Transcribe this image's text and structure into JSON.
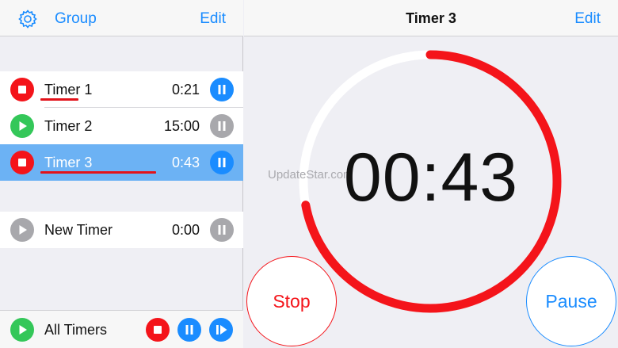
{
  "left_nav": {
    "group_label": "Group",
    "edit_label": "Edit"
  },
  "timers": [
    {
      "name": "Timer 1",
      "time": "0:21",
      "status": "running"
    },
    {
      "name": "Timer 2",
      "time": "15:00",
      "status": "idle"
    },
    {
      "name": "Timer 3",
      "time": "0:43",
      "status": "running",
      "selected": true
    }
  ],
  "new_timer": {
    "name": "New Timer",
    "time": "0:00"
  },
  "all_timers": {
    "label": "All Timers"
  },
  "detail": {
    "title": "Timer 3",
    "edit_label": "Edit",
    "remaining": "00:43",
    "progress_remaining": 0.72,
    "stop_label": "Stop",
    "pause_label": "Pause",
    "watermark": "UpdateStar.com"
  },
  "colors": {
    "accent": "#1a8cff",
    "stop": "#f4141a",
    "play": "#34c759",
    "disabled": "#a8a8ac",
    "selected_row": "#6cb2f4"
  }
}
